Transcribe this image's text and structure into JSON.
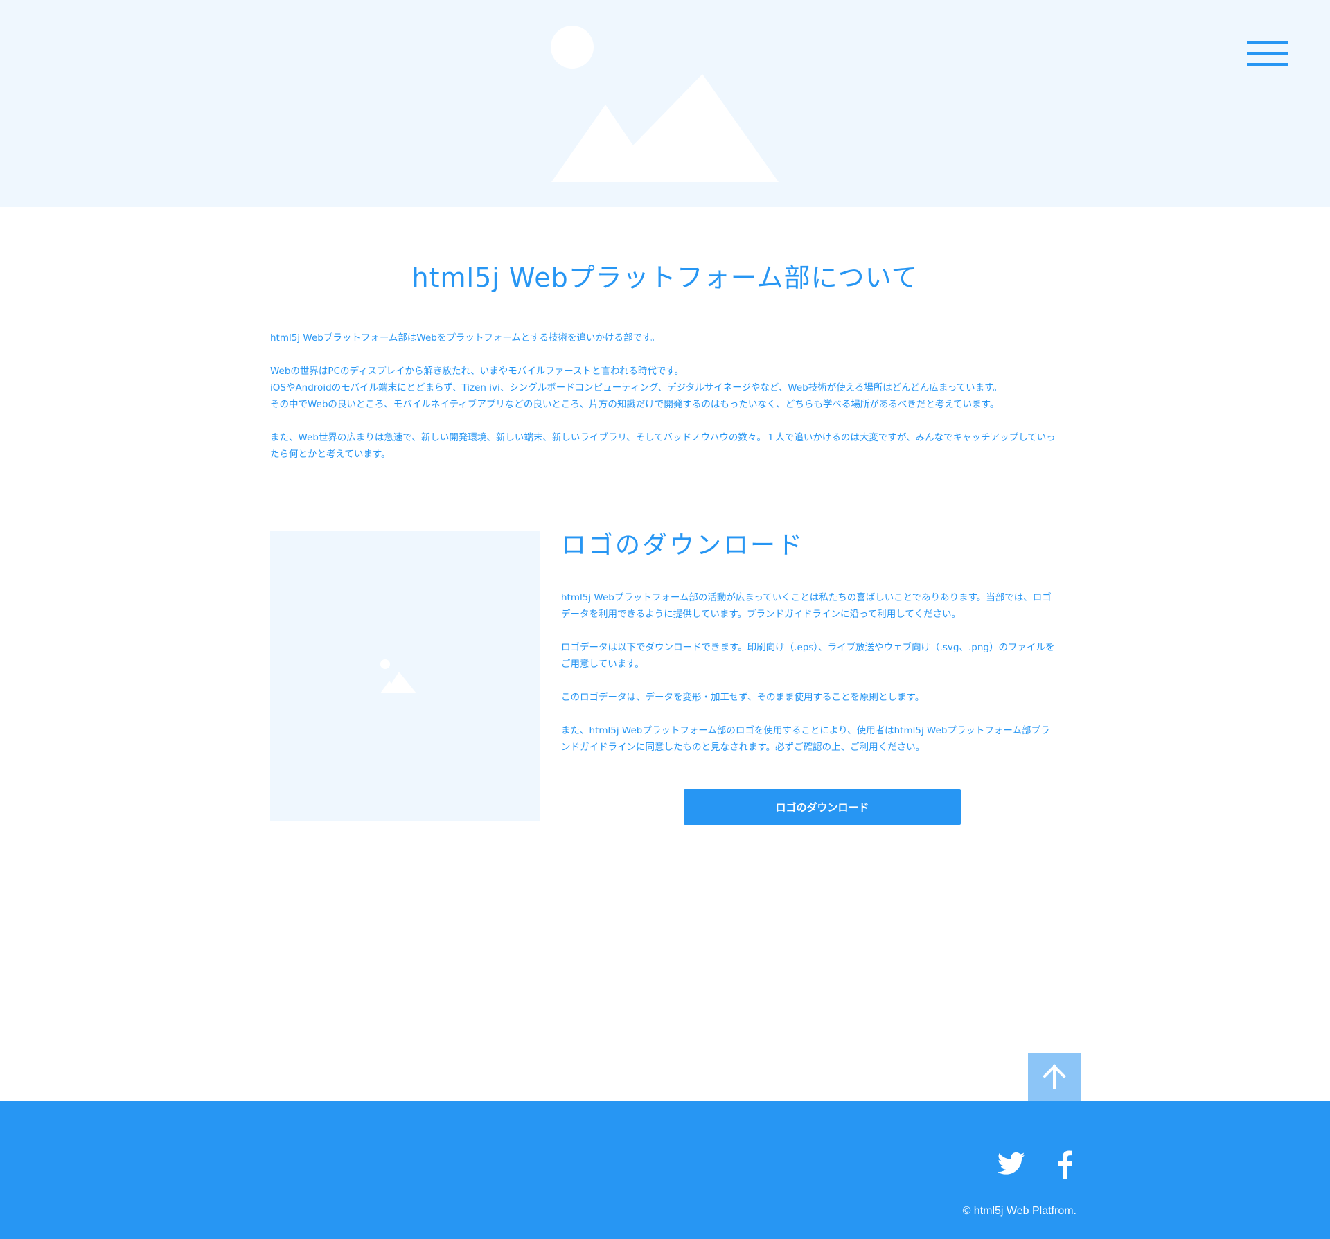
{
  "colors": {
    "accent": "#2796f3",
    "hero_background": "#eff7fe",
    "back_to_top_background": "#8cc5f7",
    "footer_background": "#2796f3",
    "footer_text": "#ffffff"
  },
  "header": {
    "hero_image_icon": "mountain-sun-placeholder",
    "menu_icon": "hamburger-menu"
  },
  "about": {
    "title": "html5j Webプラットフォーム部について",
    "paragraphs": [
      [
        "html5j Webプラットフォーム部はWebをプラットフォームとする技術を追いかける部です。"
      ],
      [
        "Webの世界はPCのディスプレイから解き放たれ、いまやモバイルファーストと言われる時代です。",
        "iOSやAndroidのモバイル端末にとどまらず、Tizen ivi、シングルボードコンピューティング、デジタルサイネージやなど、Web技術が使える場所はどんどん広まっています。",
        "その中でWebの良いところ、モバイルネイティブアプリなどの良いところ、片方の知識だけで開発するのはもったいなく、どちらも学べる場所があるべきだと考えています。"
      ],
      [
        "また、Web世界の広まりは急速で、新しい開発環境、新しい端末、新しいライブラリ、そしてバッドノウハウの数々。１人で追いかけるのは大変ですが、みんなでキャッチアップしていったら何とかと考えています。"
      ]
    ]
  },
  "logo_section": {
    "image_icon": "image-placeholder",
    "title": "ロゴのダウンロード",
    "paragraphs": [
      "html5j Webプラットフォーム部の活動が広まっていくことは私たちの喜ばしいことでありあります。当部では、ロゴデータを利用できるように提供しています。ブランドガイドラインに沿って利用してください。",
      "ロゴデータは以下でダウンロードできます。印刷向け（.eps）、ライブ放送やウェブ向け（.svg、.png）のファイルをご用意しています。",
      "このロゴデータは、データを変形・加工せず、そのまま使用することを原則とします。",
      "また、html5j Webプラットフォーム部のロゴを使用することにより、使用者はhtml5j Webプラットフォーム部ブランドガイドラインに同意したものと見なされます。必ずご確認の上、ご利用ください。"
    ],
    "download_button_label": "ロゴのダウンロード"
  },
  "back_to_top_icon": "arrow-up",
  "footer": {
    "social_icons": [
      "twitter",
      "facebook"
    ],
    "copyright": "© html5j Web Platfrom."
  }
}
